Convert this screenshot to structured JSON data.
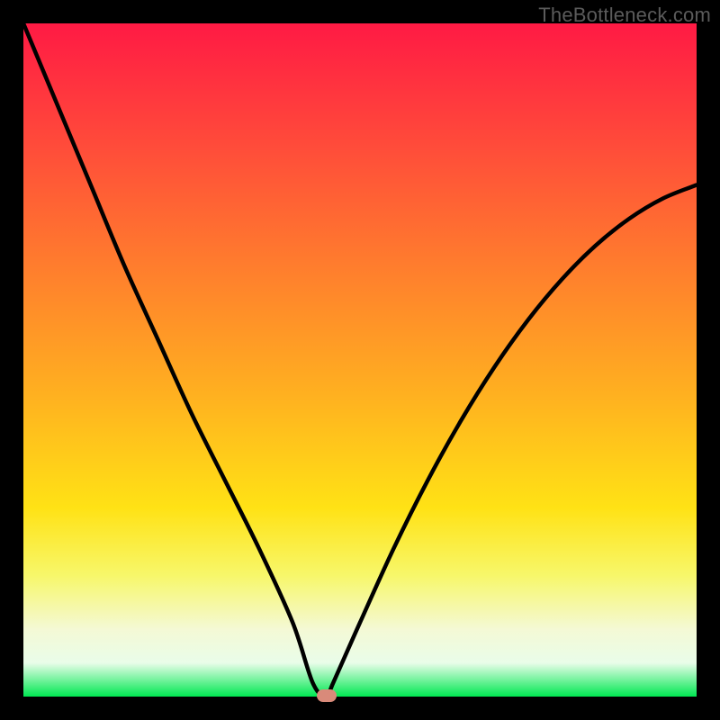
{
  "watermark": "TheBottleneck.com",
  "colors": {
    "frame": "#000000",
    "gradient_top": "#ff1a44",
    "gradient_bottom": "#00e852",
    "curve": "#000000",
    "min_marker": "#d98a7a"
  },
  "chart_data": {
    "type": "line",
    "title": "",
    "xlabel": "",
    "ylabel": "",
    "xlim": [
      0,
      100
    ],
    "ylim": [
      0,
      100
    ],
    "grid": false,
    "legend": false,
    "series": [
      {
        "name": "bottleneck-curve",
        "x": [
          0,
          5,
          10,
          15,
          20,
          25,
          30,
          35,
          40,
          43,
          45,
          46,
          50,
          55,
          60,
          65,
          70,
          75,
          80,
          85,
          90,
          95,
          100
        ],
        "values": [
          100,
          88,
          76,
          64,
          53,
          42,
          32,
          22,
          11,
          2,
          0,
          2,
          11,
          22,
          32,
          41,
          49,
          56,
          62,
          67,
          71,
          74,
          76
        ]
      }
    ],
    "minimum": {
      "x": 45,
      "y": 0
    },
    "annotations": []
  }
}
